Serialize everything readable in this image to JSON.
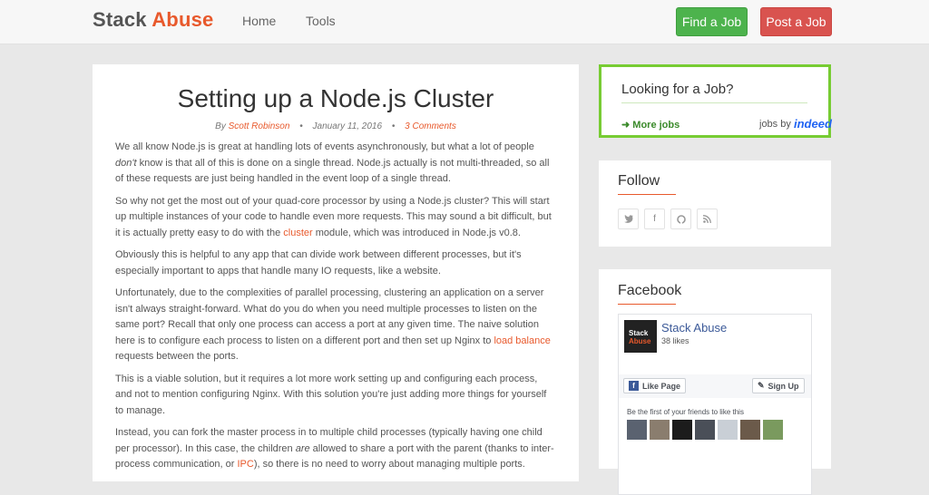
{
  "header": {
    "logo_part1": "Stack",
    "logo_part2": "Abuse",
    "nav": [
      "Home",
      "Tools"
    ],
    "find_job": "Find a Job",
    "post_job": "Post a Job"
  },
  "article": {
    "title": "Setting up a Node.js Cluster",
    "by": "By",
    "author": "Scott Robinson",
    "sep": "•",
    "date": "January 11, 2016",
    "comments": "3 Comments",
    "p1_a": "We all know Node.js is great at handling lots of events asynchronously, but what a lot of people ",
    "p1_em": "don't",
    "p1_b": " know is that all of this is done on a single thread. Node.js actually is not multi-threaded, so all of these requests are just being handled in the event loop of a single thread.",
    "p2_a": "So why not get the most out of your quad-core processor by using a Node.js cluster? This will start up multiple instances of your code to handle even more requests. This may sound a bit difficult, but it is actually pretty easy to do with the ",
    "p2_link": "cluster",
    "p2_b": " module, which was introduced in Node.js v0.8.",
    "p3": "Obviously this is helpful to any app that can divide work between different processes, but it's especially important to apps that handle many IO requests, like a website.",
    "p4_a": "Unfortunately, due to the complexities of parallel processing, clustering an application on a server isn't always straight-forward. What do you do when you need multiple processes to listen on the same port? Recall that only one process can access a port at any given time. The naive solution here is to configure each process to listen on a different port and then set up Nginx to ",
    "p4_link": "load balance",
    "p4_b": " requests between the ports.",
    "p5": "This is a viable solution, but it requires a lot more work setting up and configuring each process, and not to mention configuring Nginx. With this solution you're just adding more things for yourself to manage.",
    "p6_a": "Instead, you can fork the master process in to multiple child processes (typically having one child per processor). In this case, the children ",
    "p6_em": "are",
    "p6_b": " allowed to share a port with the parent (thanks to inter-process communication, or ",
    "p6_link": "IPC",
    "p6_c": "), so there is no need to worry about managing multiple ports."
  },
  "jobs": {
    "title": "Looking for a Job?",
    "more": "More jobs",
    "jobs_by": "jobs by",
    "indeed": "indeed"
  },
  "follow": {
    "title": "Follow",
    "icons": [
      "twitter-icon",
      "facebook-icon",
      "github-icon",
      "rss-icon"
    ]
  },
  "facebook": {
    "title": "Facebook",
    "page_name": "Stack Abuse",
    "likes": "38 likes",
    "avatar_line1": "Stack",
    "avatar_line2": "Abuse",
    "like_btn": "Like Page",
    "signup_btn": "Sign Up",
    "first": "Be the first of your friends to like this"
  },
  "colors": {
    "accent": "#e8592c",
    "find_job": "#4db34d",
    "post_job": "#d9534f",
    "job_border": "#77cc33",
    "facebook": "#3b5998"
  }
}
